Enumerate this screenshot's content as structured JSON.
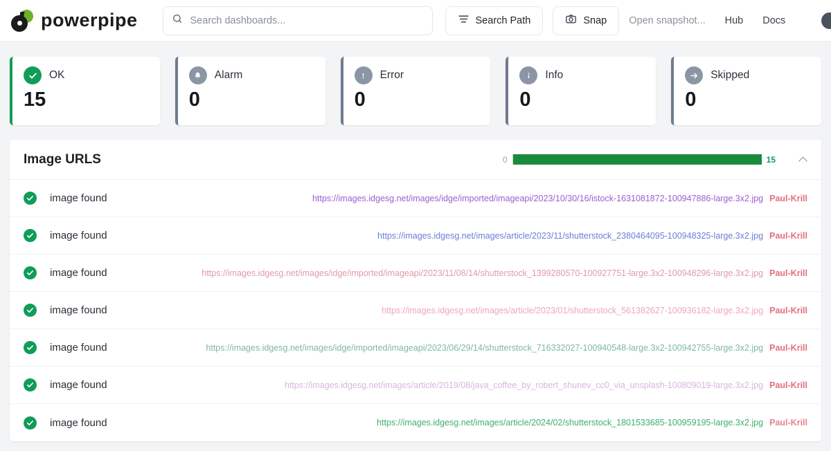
{
  "header": {
    "brand_name": "powerpipe",
    "search": {
      "placeholder": "Search dashboards...",
      "value": "",
      "icon": "search-icon"
    },
    "buttons": [
      {
        "label": "Search Path",
        "icon": "filter-lines-icon"
      },
      {
        "label": "Snap",
        "icon": "camera-icon"
      }
    ],
    "links": [
      {
        "label": "Open snapshot...",
        "muted": true
      },
      {
        "label": "Hub",
        "muted": false
      },
      {
        "label": "Docs",
        "muted": false
      }
    ],
    "avatar": "user-avatar"
  },
  "status_cards": [
    {
      "label": "OK",
      "value": "15",
      "icon": "check-circle-icon",
      "accent": "#0f9d58",
      "tone": "green"
    },
    {
      "label": "Alarm",
      "value": "0",
      "icon": "bell-icon",
      "accent": "#6e7b8f",
      "tone": "gray"
    },
    {
      "label": "Error",
      "value": "0",
      "icon": "exclamation-icon",
      "accent": "#6e7b8f",
      "tone": "gray"
    },
    {
      "label": "Info",
      "value": "0",
      "icon": "info-icon",
      "accent": "#6e7b8f",
      "tone": "gray"
    },
    {
      "label": "Skipped",
      "value": "0",
      "icon": "arrow-right-icon",
      "accent": "#6e7b8f",
      "tone": "gray"
    }
  ],
  "panel": {
    "title": "Image URLS",
    "progress": {
      "min_label": "0",
      "max_label": "15",
      "min": 0,
      "max": 15,
      "value": 15,
      "percent": 100,
      "fill_color": "#1a8a3c"
    },
    "collapse_icon": "chevron-up-icon",
    "rows": [
      {
        "status": "image found",
        "url": "https://images.idgesg.net/images/idge/imported/imageapi/2023/10/30/16/istock-1631081872-100947886-large.3x2.jpg",
        "url_color": "#9b5fd0",
        "author": "Paul-Krill",
        "author_color": "#e0707c"
      },
      {
        "status": "image found",
        "url": "https://images.idgesg.net/images/article/2023/11/shutterstock_2380464095-100948325-large.3x2.jpg",
        "url_color": "#6a7fd6",
        "author": "Paul-Krill",
        "author_color": "#e0707c"
      },
      {
        "status": "image found",
        "url": "https://images.idgesg.net/images/idge/imported/imageapi/2023/11/08/14/shutterstock_1399280570-100927751-large.3x2-100948296-large.3x2.jpg",
        "url_color": "#e09aa6",
        "author": "Paul-Krill",
        "author_color": "#e0707c"
      },
      {
        "status": "image found",
        "url": "https://images.idgesg.net/images/article/2023/01/shutterstock_561382627-100936182-large.3x2.jpg",
        "url_color": "#f0a5c0",
        "author": "Paul-Krill",
        "author_color": "#e0707c"
      },
      {
        "status": "image found",
        "url": "https://images.idgesg.net/images/idge/imported/imageapi/2023/06/29/14/shutterstock_716332027-100940548-large.3x2-100942755-large.3x2.jpg",
        "url_color": "#7eb8a4",
        "author": "Paul-Krill",
        "author_color": "#e0707c"
      },
      {
        "status": "image found",
        "url": "https://images.idgesg.net/images/article/2019/08/java_coffee_by_robert_shunev_cc0_via_unsplash-100809019-large.3x2.jpg",
        "url_color": "#d8b6dd",
        "author": "Paul-Krill",
        "author_color": "#e0707c"
      },
      {
        "status": "image found",
        "url": "https://images.idgesg.net/images/article/2024/02/shutterstock_1801533685-100959195-large.3x2.jpg",
        "url_color": "#3fae6e",
        "author": "Paul-Krill",
        "author_color": "#e8848e"
      }
    ]
  }
}
